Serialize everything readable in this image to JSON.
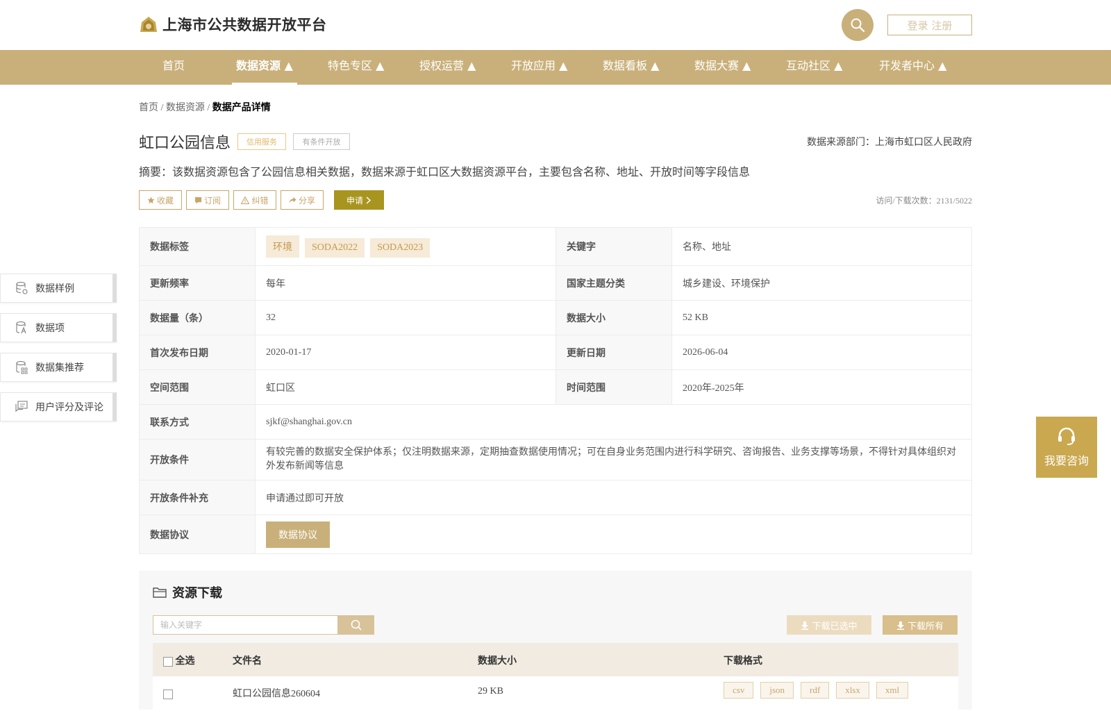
{
  "header": {
    "brand": "上海市公共数据开放平台",
    "login": "登录 注册"
  },
  "nav": {
    "items": [
      {
        "label": "首页",
        "active": false
      },
      {
        "label": "数据资源 ▲",
        "active": true
      },
      {
        "label": "特色专区 ▲",
        "active": false
      },
      {
        "label": "授权运营 ▲",
        "active": false
      },
      {
        "label": "开放应用 ▲",
        "active": false
      },
      {
        "label": "数据看板 ▲",
        "active": false
      },
      {
        "label": "数据大赛 ▲",
        "active": false
      },
      {
        "label": "互动社区 ▲",
        "active": false
      },
      {
        "label": "开发者中心 ▲",
        "active": false
      }
    ]
  },
  "breadcrumb": {
    "home": "首页",
    "sep": " / ",
    "resource": "数据资源",
    "current": "数据产品详情"
  },
  "product": {
    "title": "虹口公园信息",
    "tag_credit": "信用服务",
    "tag_condition": "有条件开放",
    "source": "数据来源部门：上海市虹口区人民政府",
    "abstract": "摘要：该数据资源包含了公园信息相关数据，数据来源于虹口区大数据资源平台，主要包含名称、地址、开放时间等字段信息",
    "visits": "访问/下载次数：2131/5022"
  },
  "actions": {
    "favorite": "收藏",
    "subscribe": "订阅",
    "correct": "纠错",
    "share": "分享",
    "apply": "申请"
  },
  "info": {
    "tags_label": "数据标签",
    "tags": [
      "环境",
      "SODA2022",
      "SODA2023"
    ],
    "keywords_label": "关键字",
    "keywords": "名称、地址",
    "freq_label": "更新频率",
    "freq": "每年",
    "theme_label": "国家主题分类",
    "theme": "城乡建设、环境保护",
    "count_label": "数据量（条）",
    "count": "32",
    "size_label": "数据大小",
    "size": "52 KB",
    "first_label": "首次发布日期",
    "first": "2020-01-17",
    "updated_label": "更新日期",
    "updated": "2026-06-04",
    "space_label": "空间范围",
    "space": "虹口区",
    "time_label": "时间范围",
    "time": "2020年-2025年",
    "contact_label": "联系方式",
    "contact": "sjkf@shanghai.gov.cn",
    "cond_label": "开放条件",
    "cond": "有较完善的数据安全保护体系；仅注明数据来源，定期抽查数据使用情况；可在自身业务范围内进行科学研究、咨询报告、业务支撑等场景，不得针对具体组织对外发布新闻等信息",
    "cond_extra_label": "开放条件补充",
    "cond_extra": "申请通过即可开放",
    "agreement_label": "数据协议",
    "agreement_btn": "数据协议"
  },
  "side": {
    "sample": "数据样例",
    "items": "数据项",
    "recommend": "数据集推荐",
    "reviews": "用户评分及评论"
  },
  "consult": {
    "label": "我要咨询"
  },
  "resources": {
    "title": "资源下载",
    "search_placeholder": "输入关键字",
    "download_selected": "下载已选中",
    "download_all": "下载所有",
    "col_selectall": "全选",
    "col_filename": "文件名",
    "col_size": "数据大小",
    "col_formats": "下载格式",
    "rows": [
      {
        "filename": "虹口公园信息260604",
        "size": "29 KB",
        "formats": [
          "csv",
          "json",
          "rdf",
          "xlsx",
          "xml"
        ]
      }
    ]
  },
  "colors": {
    "accent": "#c9b07a",
    "apply": "#a8951f",
    "consult": "#c9a84f"
  }
}
